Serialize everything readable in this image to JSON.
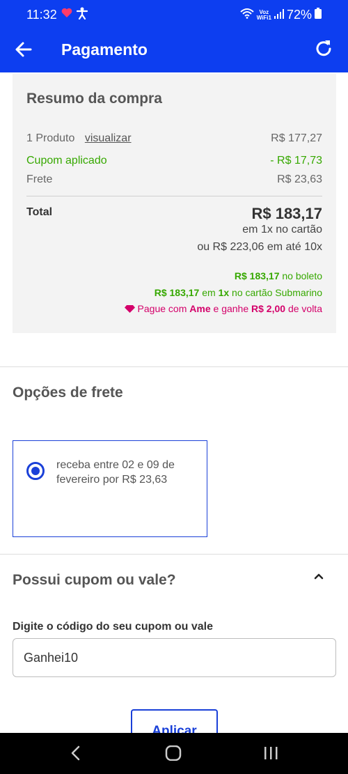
{
  "status_bar": {
    "time": "11:32",
    "network_label": "Voz\nWiFi1",
    "battery": "72%"
  },
  "app_bar": {
    "title": "Pagamento",
    "icons": [
      "arrow-left-icon",
      "refresh-icon"
    ]
  },
  "summary": {
    "heading": "Resumo da compra",
    "product_label": "1 Produto",
    "view_link": "visualizar",
    "product_value": "R$ 177,27",
    "coupon_label": "Cupom aplicado",
    "coupon_value": "- R$ 17,73",
    "shipping_label": "Frete",
    "shipping_value": "R$ 23,63",
    "total_label": "Total",
    "total_value": "R$ 183,17",
    "total_sub": "em 1x no cartão",
    "installments": "ou R$ 223,06 em até 10x",
    "boleto_value": "R$ 183,17",
    "boleto_text": "no boleto",
    "submarino_value": "R$ 183,17",
    "submarino_mid": "em",
    "submarino_times": "1x",
    "submarino_text": "no cartão Submarino",
    "ame_prefix": "Pague com",
    "ame_brand": "Ame",
    "ame_mid": "e ganhe",
    "ame_value": "R$ 2,00",
    "ame_suffix": "de volta"
  },
  "shipping_options": {
    "title": "Opções de frete",
    "option_text": "receba entre 02 e 09 de fevereiro por R$ 23,63",
    "selected": true
  },
  "coupon": {
    "title": "Possui cupom ou vale?",
    "field_label": "Digite o código do seu cupom ou vale",
    "value": "Ganhei10",
    "apply_label": "Aplicar"
  },
  "colors": {
    "brand_blue": "#0d3ef0",
    "success_green": "#36a800",
    "ame_pink": "#d4006a"
  }
}
